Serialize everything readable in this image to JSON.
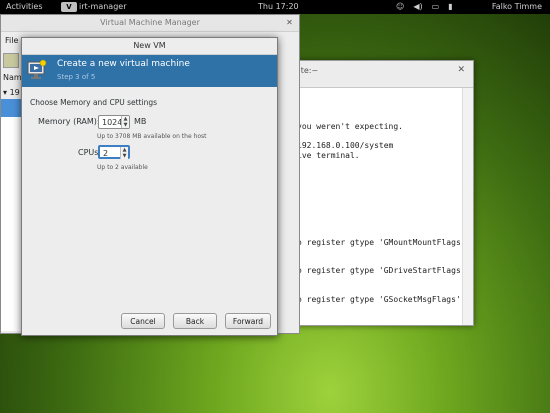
{
  "top_panel": {
    "activities": "Activities",
    "app_name": "irt-manager",
    "app_logo": "V",
    "clock": "Thu 17:20",
    "user": "Falko Timme",
    "tray_icons": [
      "accessibility-icon",
      "volume-icon",
      "network-icon",
      "battery-icon"
    ]
  },
  "vmm_window": {
    "title": "Virtual Machine Manager",
    "menu_file": "File",
    "column_name": "Name",
    "host_row": "19"
  },
  "terminal": {
    "title": "w.site:~",
    "lines": [
      " you weren't expecting.",
      "192.168.0.100/system",
      "ive terminal.",
      "o register gtype 'GMountMountFlags'",
      "o register gtype 'GDriveStartFlags'",
      "o register gtype 'GSocketMsgFlags'"
    ]
  },
  "dialog": {
    "title": "New VM",
    "header_title": "Create a new virtual machine",
    "header_step": "Step 3 of 5",
    "section_label": "Choose Memory and CPU settings",
    "memory_label": "Memory (RAM):",
    "memory_value": "1024",
    "memory_unit": "MB",
    "memory_hint": "Up to 3708 MB available on the host",
    "cpus_label": "CPUs:",
    "cpus_value": "2",
    "cpus_hint": "Up to 2 available",
    "btn_cancel": "Cancel",
    "btn_back": "Back",
    "btn_forward": "Forward"
  }
}
